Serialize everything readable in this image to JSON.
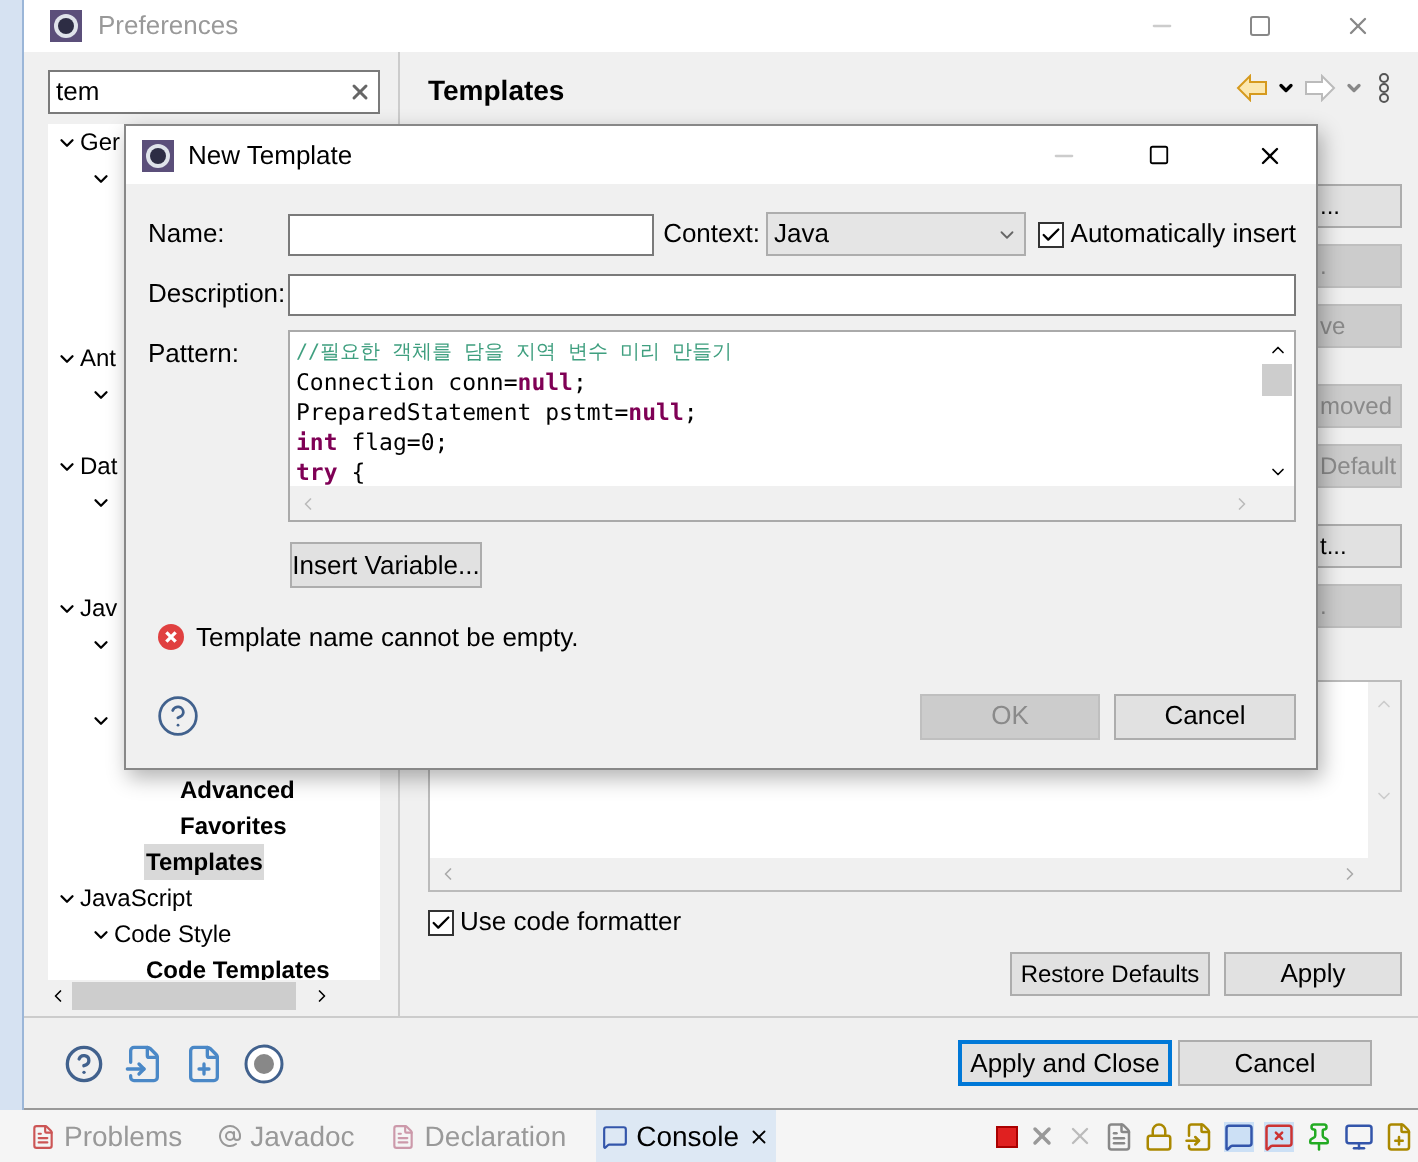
{
  "preferences": {
    "title": "Preferences",
    "filter": {
      "value": "tem"
    },
    "tree": [
      {
        "label": "Ger",
        "expanded": true,
        "children": [
          {
            "expanded": true
          }
        ]
      },
      {
        "label": "Ant",
        "expanded": true,
        "children": [
          {
            "expanded": true
          }
        ]
      },
      {
        "label": "Dat",
        "expanded": true,
        "children": [
          {
            "expanded": true
          }
        ]
      },
      {
        "label": "Jav",
        "expanded": true,
        "children": [
          {
            "expanded": true
          },
          {
            "expanded": true,
            "children": [
              {
                "children": [
                  {
                    "label": "Advanced",
                    "highlighted": true,
                    "selected": false
                  },
                  {
                    "label": "Favorites",
                    "highlighted": true,
                    "selected": false
                  }
                ]
              },
              {
                "label": "Templates",
                "highlighted": true,
                "selected": true
              }
            ]
          }
        ]
      },
      {
        "label": "JavaScript",
        "expanded": true,
        "children": [
          {
            "label": "Code Style",
            "expanded": true,
            "children": [
              {
                "label": "Code Templates",
                "highlighted": true,
                "selected": false
              }
            ]
          }
        ]
      }
    ],
    "page_title": "Templates",
    "side_buttons": [
      {
        "label": "...",
        "disabled": false
      },
      {
        "label": ".",
        "disabled": true
      },
      {
        "label": "ve",
        "disabled": true
      },
      {
        "label": "moved",
        "disabled": true
      },
      {
        "label": "Default",
        "disabled": true
      },
      {
        "label": "t...",
        "disabled": false
      },
      {
        "label": ".",
        "disabled": true
      }
    ],
    "use_code_formatter": {
      "label": "Use code formatter",
      "checked": true
    },
    "restore_defaults": "Restore Defaults",
    "apply": "Apply",
    "apply_and_close": "Apply and Close",
    "cancel": "Cancel"
  },
  "dialog": {
    "title": "New Template",
    "name_label": "Name:",
    "context_label": "Context:",
    "context_value": "Java",
    "auto_insert": {
      "label": "Automatically insert",
      "checked": true
    },
    "description_label": "Description:",
    "pattern_label": "Pattern:",
    "pattern": [
      [
        {
          "kind": "comment",
          "text": "//필요한 객체를 담을 지역 변수 미리 만들기"
        }
      ],
      [
        {
          "kind": "plain",
          "text": "Connection conn="
        },
        {
          "kind": "keyword",
          "text": "null"
        },
        {
          "kind": "plain",
          "text": ";"
        }
      ],
      [
        {
          "kind": "plain",
          "text": "PreparedStatement pstmt="
        },
        {
          "kind": "keyword",
          "text": "null"
        },
        {
          "kind": "plain",
          "text": ";"
        }
      ],
      [
        {
          "kind": "keyword",
          "text": "int"
        },
        {
          "kind": "plain",
          "text": " flag=0;"
        }
      ],
      [
        {
          "kind": "keyword",
          "text": "try"
        },
        {
          "kind": "plain",
          "text": " {"
        }
      ]
    ],
    "insert_variable": "Insert Variable...",
    "error": "Template name cannot be empty.",
    "ok": {
      "label": "OK",
      "disabled": true
    },
    "cancel": "Cancel"
  },
  "views": [
    {
      "label": "Problems",
      "selected": false
    },
    {
      "label": "Javadoc",
      "selected": false
    },
    {
      "label": "Declaration",
      "selected": false
    },
    {
      "label": "Console",
      "selected": true
    }
  ]
}
